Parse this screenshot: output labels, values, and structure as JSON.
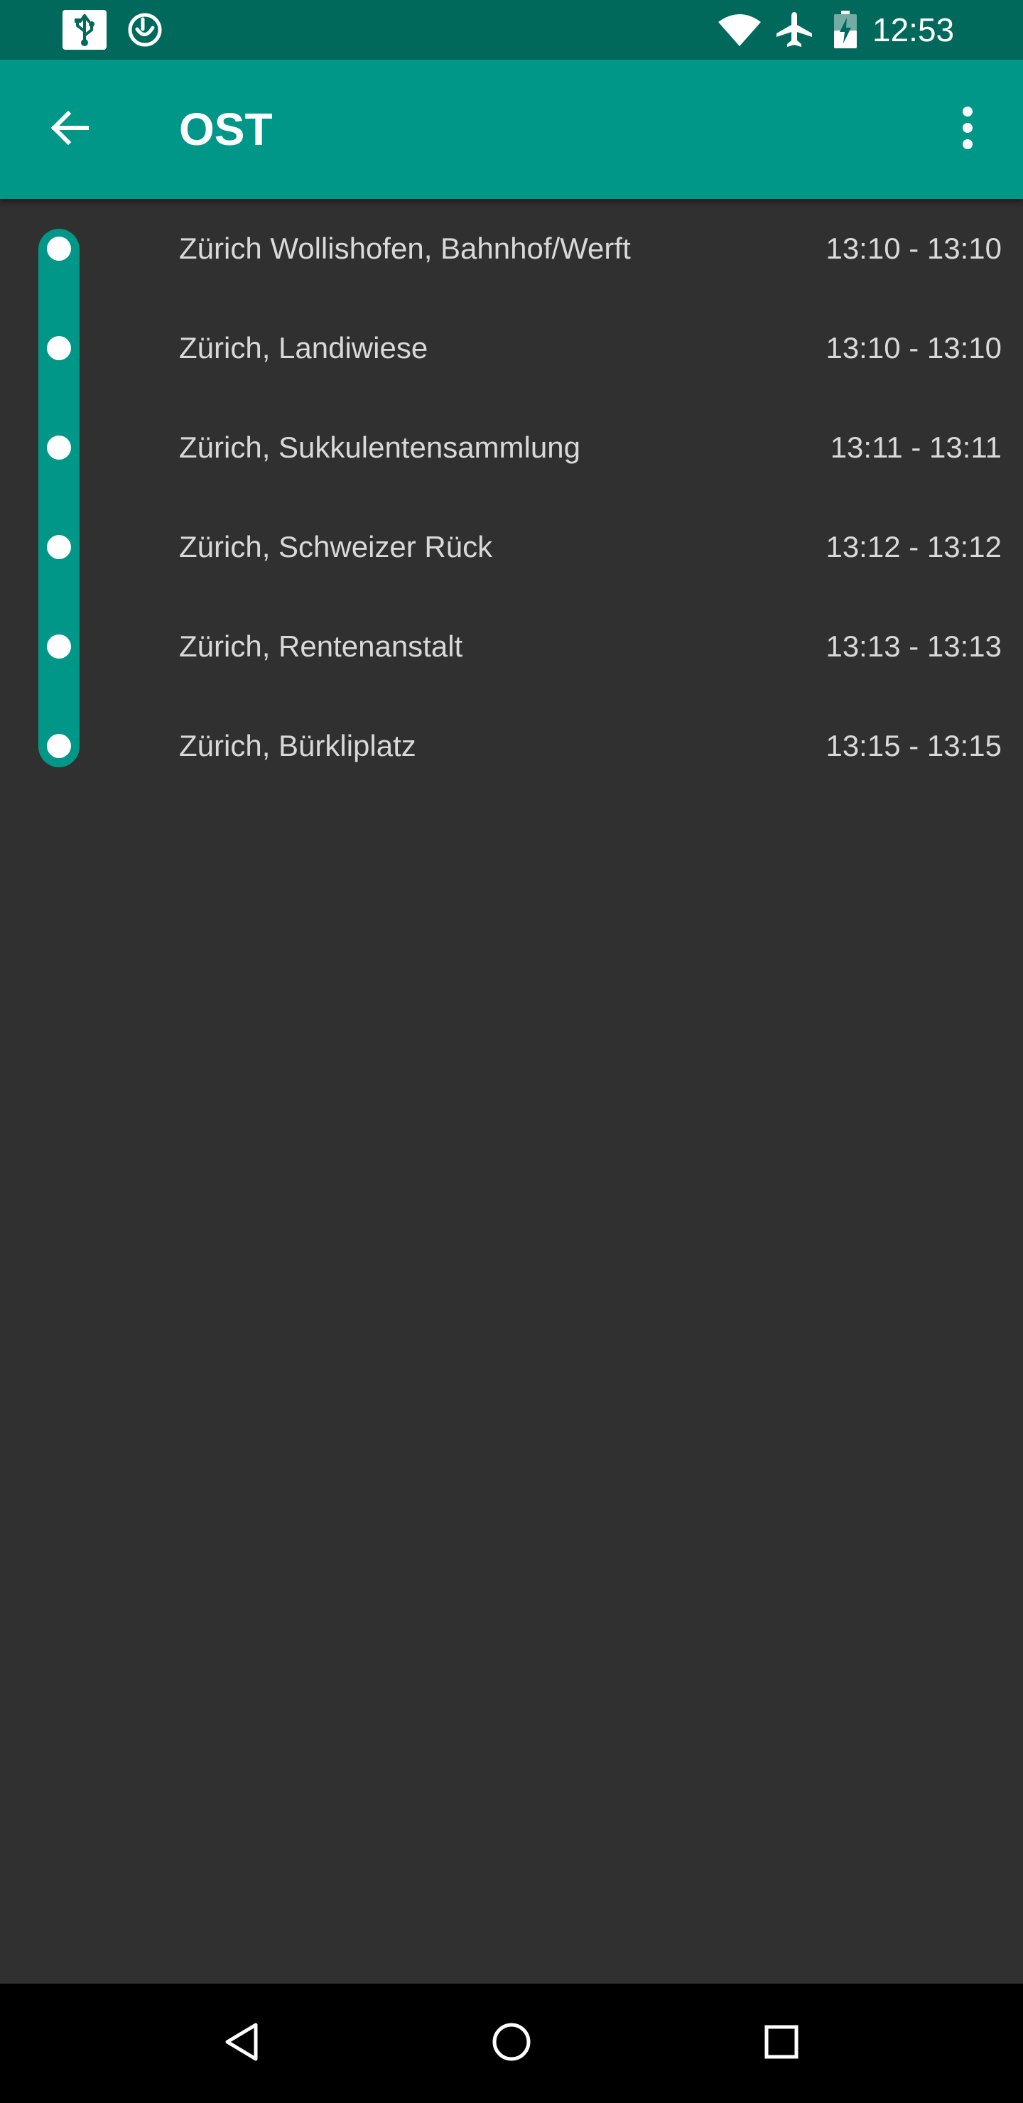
{
  "status_bar": {
    "time": "12:53",
    "icons": [
      "usb-icon",
      "app-notification-icon",
      "wifi-icon",
      "airplane-mode-icon",
      "battery-charging-icon"
    ]
  },
  "app_bar": {
    "title": "OST",
    "back_icon": "arrow-back-icon",
    "menu_icon": "more-vert-icon"
  },
  "stops": [
    {
      "name": "Zürich Wollishofen, Bahnhof/Werft",
      "time": "13:10 - 13:10"
    },
    {
      "name": "Zürich, Landiwiese",
      "time": "13:10 - 13:10"
    },
    {
      "name": "Zürich, Sukkulentensammlung",
      "time": "13:11 - 13:11"
    },
    {
      "name": "Zürich, Schweizer Rück",
      "time": "13:12 - 13:12"
    },
    {
      "name": "Zürich, Rentenanstalt",
      "time": "13:13 - 13:13"
    },
    {
      "name": "Zürich, Bürkliplatz",
      "time": "13:15 - 13:15"
    }
  ],
  "nav_bar": {
    "icons": [
      "nav-back-icon",
      "nav-home-icon",
      "nav-recents-icon"
    ]
  },
  "colors": {
    "status_bar": "#00695c",
    "app_bar": "#009688",
    "background": "#303030",
    "route_line": "#009688",
    "text": "#d9d9d9"
  }
}
